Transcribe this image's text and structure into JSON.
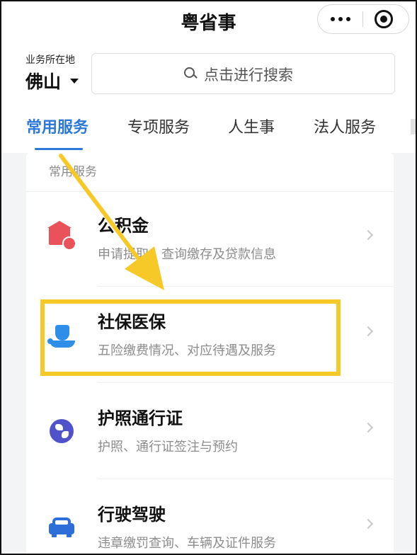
{
  "titlebar": {
    "title": "粤省事",
    "more_icon": "more-dots-icon",
    "close_icon": "miniprogram-close-icon"
  },
  "header": {
    "location_label": "业务所在地",
    "city": "佛山",
    "search_placeholder": "点击进行搜索"
  },
  "tabs": [
    {
      "label": "常用服务",
      "active": true
    },
    {
      "label": "专项服务",
      "active": false
    },
    {
      "label": "人生事",
      "active": false
    },
    {
      "label": "法人服务",
      "active": false
    }
  ],
  "section": {
    "title": "常用服务",
    "items": [
      {
        "title": "公积金",
        "desc": "申请提取、查询缴存及贷款信息",
        "icon": "housing-fund-icon",
        "color": "#e9525b"
      },
      {
        "title": "社保医保",
        "desc": "五险缴费情况、对应待遇及服务",
        "icon": "social-security-icon",
        "color": "#2f8fe8"
      },
      {
        "title": "护照通行证",
        "desc": "护照、通行证签注与预约",
        "icon": "globe-icon",
        "color": "#4f52c9"
      },
      {
        "title": "行驶驾驶",
        "desc": "违章缴罚查询、车辆及证件服务",
        "icon": "car-icon",
        "color": "#2d6ed8"
      }
    ]
  },
  "colors": {
    "accent": "#2b78d9",
    "annotation": "#f7c928"
  }
}
